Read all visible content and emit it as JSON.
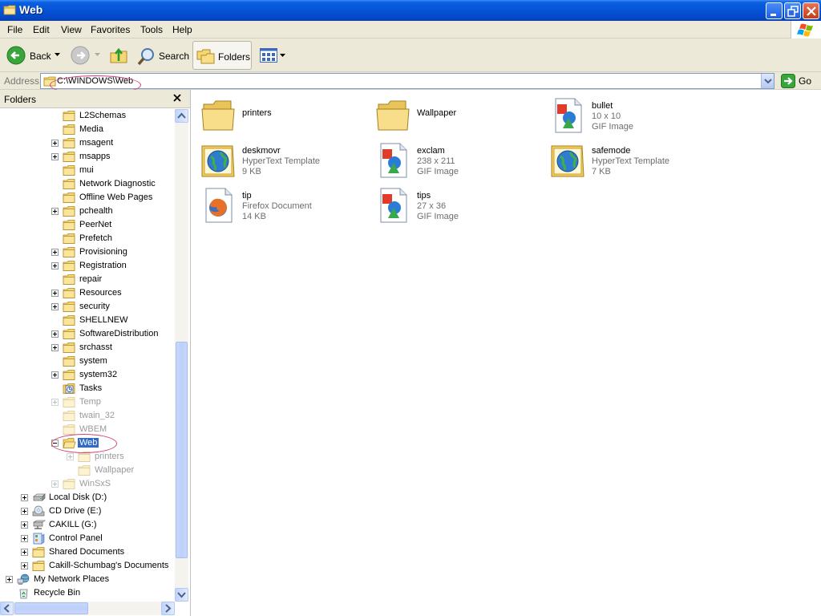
{
  "window": {
    "title": "Web",
    "icons": {
      "app": "folder-icon",
      "minimize": "minimize-icon",
      "maximize": "restore-icon",
      "close": "close-icon"
    }
  },
  "menu": {
    "items": [
      "File",
      "Edit",
      "View",
      "Favorites",
      "Tools",
      "Help"
    ]
  },
  "toolbar": {
    "back_label": "Back",
    "search_label": "Search",
    "folders_label": "Folders"
  },
  "address": {
    "label": "Address",
    "value": "C:\\WINDOWS\\Web",
    "go_label": "Go"
  },
  "folders_pane": {
    "title": "Folders",
    "tree": [
      {
        "label": "L2Schemas",
        "expander": "none",
        "icon": "folder-icon",
        "state": "normal"
      },
      {
        "label": "Media",
        "expander": "none",
        "icon": "folder-icon",
        "state": "normal"
      },
      {
        "label": "msagent",
        "expander": "plus",
        "icon": "folder-icon",
        "state": "normal"
      },
      {
        "label": "msapps",
        "expander": "plus",
        "icon": "folder-icon",
        "state": "normal"
      },
      {
        "label": "mui",
        "expander": "none",
        "icon": "folder-icon",
        "state": "normal"
      },
      {
        "label": "Network Diagnostic",
        "expander": "none",
        "icon": "folder-icon",
        "state": "normal"
      },
      {
        "label": "Offline Web Pages",
        "expander": "none",
        "icon": "folder-icon",
        "state": "normal"
      },
      {
        "label": "pchealth",
        "expander": "plus",
        "icon": "folder-icon",
        "state": "normal"
      },
      {
        "label": "PeerNet",
        "expander": "none",
        "icon": "folder-icon",
        "state": "normal"
      },
      {
        "label": "Prefetch",
        "expander": "none",
        "icon": "folder-icon",
        "state": "normal"
      },
      {
        "label": "Provisioning",
        "expander": "plus",
        "icon": "folder-icon",
        "state": "normal"
      },
      {
        "label": "Registration",
        "expander": "plus",
        "icon": "folder-icon",
        "state": "normal"
      },
      {
        "label": "repair",
        "expander": "none",
        "icon": "folder-icon",
        "state": "normal"
      },
      {
        "label": "Resources",
        "expander": "plus",
        "icon": "folder-icon",
        "state": "normal"
      },
      {
        "label": "security",
        "expander": "plus",
        "icon": "folder-icon",
        "state": "normal"
      },
      {
        "label": "SHELLNEW",
        "expander": "none",
        "icon": "folder-icon",
        "state": "normal"
      },
      {
        "label": "SoftwareDistribution",
        "expander": "plus",
        "icon": "folder-icon",
        "state": "normal"
      },
      {
        "label": "srchasst",
        "expander": "plus",
        "icon": "folder-icon",
        "state": "normal"
      },
      {
        "label": "system",
        "expander": "none",
        "icon": "folder-icon",
        "state": "normal"
      },
      {
        "label": "system32",
        "expander": "plus",
        "icon": "folder-icon",
        "state": "normal"
      },
      {
        "label": "Tasks",
        "expander": "none",
        "icon": "tasks-folder-icon",
        "state": "normal"
      },
      {
        "label": "Temp",
        "expander": "plus",
        "icon": "folder-icon",
        "state": "dim"
      },
      {
        "label": "twain_32",
        "expander": "none",
        "icon": "folder-icon",
        "state": "dim"
      },
      {
        "label": "WBEM",
        "expander": "none",
        "icon": "folder-icon",
        "state": "dim"
      },
      {
        "label": "Web",
        "expander": "minus",
        "icon": "open-folder-icon",
        "state": "selected"
      },
      {
        "label": "printers",
        "expander": "plus",
        "icon": "folder-icon",
        "state": "dim"
      },
      {
        "label": "Wallpaper",
        "expander": "none",
        "icon": "folder-icon",
        "state": "dim"
      },
      {
        "label": "WinSxS",
        "expander": "plus",
        "icon": "folder-icon",
        "state": "dim"
      },
      {
        "label": "Local Disk (D:)",
        "expander": "plus",
        "icon": "hard-disk-icon",
        "state": "normal"
      },
      {
        "label": "CD Drive (E:)",
        "expander": "plus",
        "icon": "cd-drive-icon",
        "state": "normal"
      },
      {
        "label": "CAKILL (G:)",
        "expander": "plus",
        "icon": "network-drive-icon",
        "state": "normal"
      },
      {
        "label": "Control Panel",
        "expander": "plus",
        "icon": "control-panel-icon",
        "state": "normal"
      },
      {
        "label": "Shared Documents",
        "expander": "plus",
        "icon": "folder-icon",
        "state": "normal"
      },
      {
        "label": "Cakill-Schumbag's Documents",
        "expander": "plus",
        "icon": "folder-icon",
        "state": "normal"
      },
      {
        "label": "My Network Places",
        "expander": "plus",
        "icon": "network-places-icon",
        "state": "normal"
      },
      {
        "label": "Recycle Bin",
        "expander": "none",
        "icon": "recycle-bin-icon",
        "state": "normal"
      }
    ]
  },
  "files": [
    {
      "name": "printers",
      "type": "",
      "size": "",
      "icon": "folder-icon"
    },
    {
      "name": "Wallpaper",
      "type": "",
      "size": "",
      "icon": "folder-icon"
    },
    {
      "name": "bullet",
      "type": "10 x 10",
      "size": "GIF Image",
      "icon": "gif-image-icon"
    },
    {
      "name": "deskmovr",
      "type": "HyperText Template",
      "size": "9 KB",
      "icon": "htt-template-icon"
    },
    {
      "name": "exclam",
      "type": "238 x 211",
      "size": "GIF Image",
      "icon": "gif-image-icon"
    },
    {
      "name": "safemode",
      "type": "HyperText Template",
      "size": "7 KB",
      "icon": "htt-template-icon"
    },
    {
      "name": "tip",
      "type": "Firefox Document",
      "size": "14 KB",
      "icon": "firefox-document-icon"
    },
    {
      "name": "tips",
      "type": "27 x 36",
      "size": "GIF Image",
      "icon": "gif-image-icon"
    }
  ],
  "colors": {
    "titlebar": "#0553d8",
    "selection": "#316ac5",
    "annotation": "#d0457a"
  }
}
